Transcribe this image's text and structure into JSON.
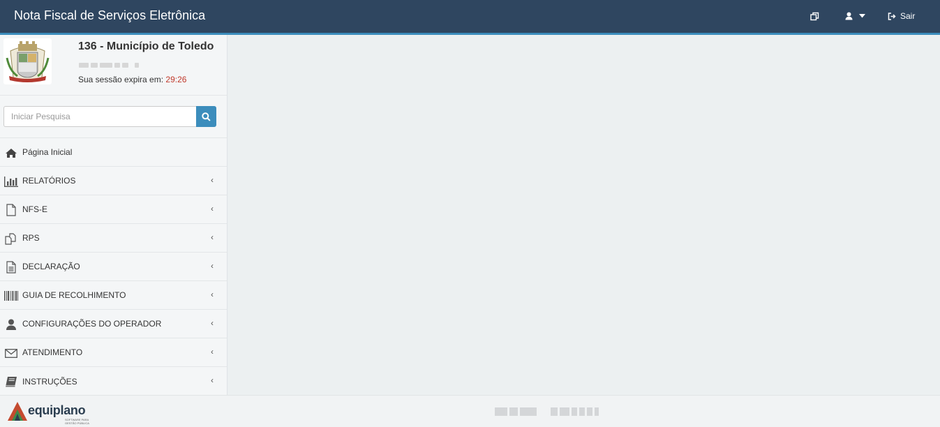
{
  "header": {
    "title": "Nota Fiscal de Serviços Eletrônica",
    "logout_label": "Sair",
    "accent": "#2f4660"
  },
  "profile": {
    "municipality": "136 - Município de Toledo",
    "session_label": "Sua sessão expira em:",
    "session_timer": "29:26"
  },
  "search": {
    "placeholder": "Iniciar Pesquisa"
  },
  "menu": [
    {
      "label": "Página Inicial",
      "icon": "home-icon"
    },
    {
      "label": "RELATÓRIOS",
      "icon": "bar-chart-icon"
    },
    {
      "label": "NFS-E",
      "icon": "file-icon"
    },
    {
      "label": "RPS",
      "icon": "copy-icon"
    },
    {
      "label": "DECLARAÇÃO",
      "icon": "file-text-icon"
    },
    {
      "label": "GUIA DE RECOLHIMENTO",
      "icon": "barcode-icon"
    },
    {
      "label": "CONFIGURAÇÕES DO OPERADOR",
      "icon": "user-icon"
    },
    {
      "label": "ATENDIMENTO",
      "icon": "envelope-icon"
    },
    {
      "label": "INSTRUÇÕES",
      "icon": "book-icon"
    }
  ],
  "footer": {
    "brand": "equiplano",
    "brand_tagline": "SOFTWARE PARA GESTÃO PÚBLICA"
  }
}
